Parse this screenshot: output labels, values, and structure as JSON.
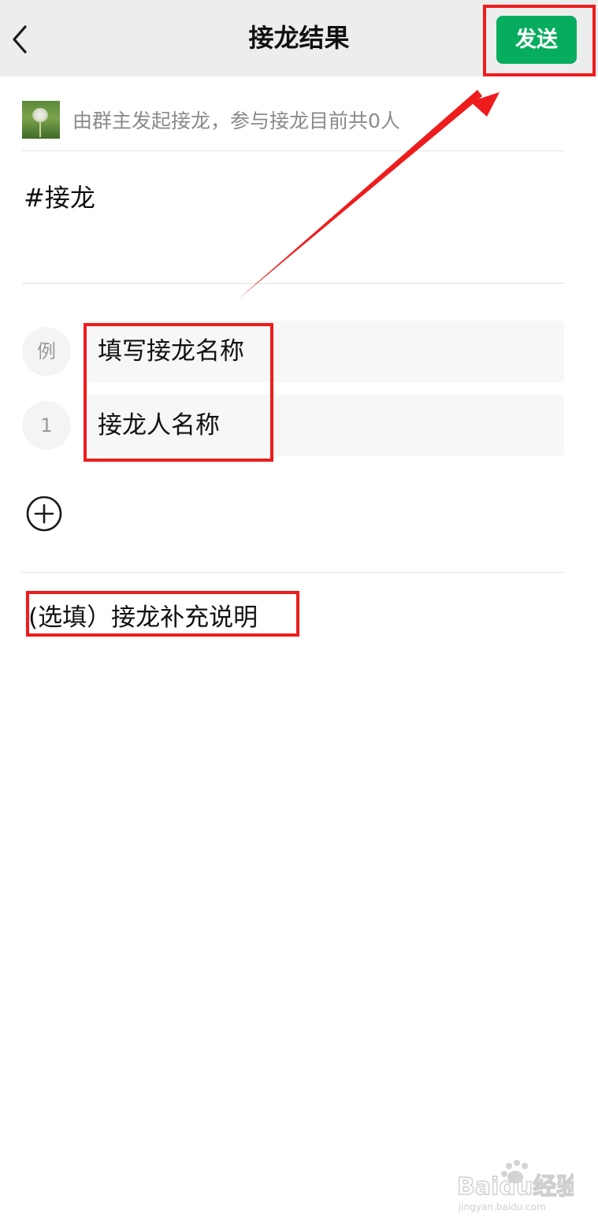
{
  "header": {
    "title": "接龙结果",
    "send_label": "发送"
  },
  "info": {
    "text": "由群主发起接龙，参与接龙目前共0人"
  },
  "topic": "#接龙",
  "entries": [
    {
      "badge": "例",
      "placeholder": "填写接龙名称"
    },
    {
      "badge": "1",
      "placeholder": "接龙人名称"
    }
  ],
  "supplement_placeholder": "(选填）接龙补充说明",
  "watermark": {
    "brand": "Baidu经验",
    "url": "jingyan.baidu.com"
  },
  "colors": {
    "header_bg": "#ededed",
    "send_button": "#07ad5e",
    "annotation_red": "#ee1c1c",
    "secondary_text": "#8a8a8a"
  },
  "icons": {
    "back": "chevron-left-icon",
    "add": "plus-circle-icon"
  }
}
